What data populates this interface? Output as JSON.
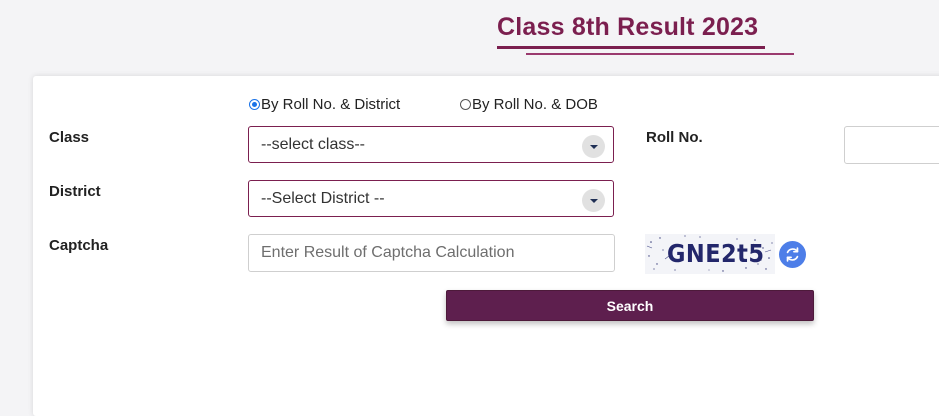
{
  "page": {
    "title": "Class 8th Result 2023"
  },
  "search_mode": {
    "options": [
      {
        "label": "By Roll No. & District",
        "selected": true
      },
      {
        "label": "By Roll No. & DOB",
        "selected": false
      }
    ]
  },
  "form": {
    "class": {
      "label": "Class",
      "selected_value": "--select class--"
    },
    "district": {
      "label": "District",
      "selected_value": "--Select District --"
    },
    "roll_no": {
      "label": "Roll No.",
      "value": "",
      "placeholder": ""
    },
    "captcha": {
      "label": "Captcha",
      "value": "",
      "placeholder": "Enter Result of Captcha Calculation",
      "image_text": "GNE2t5"
    },
    "search_button_label": "Search"
  },
  "colors": {
    "brand": "#7b1f4f",
    "button": "#5e1f4e",
    "refresh": "#4d7ee8",
    "radio_selected": "#1a73e8"
  },
  "icons": {
    "dropdown": "chevron-down-icon",
    "refresh": "refresh-icon"
  }
}
